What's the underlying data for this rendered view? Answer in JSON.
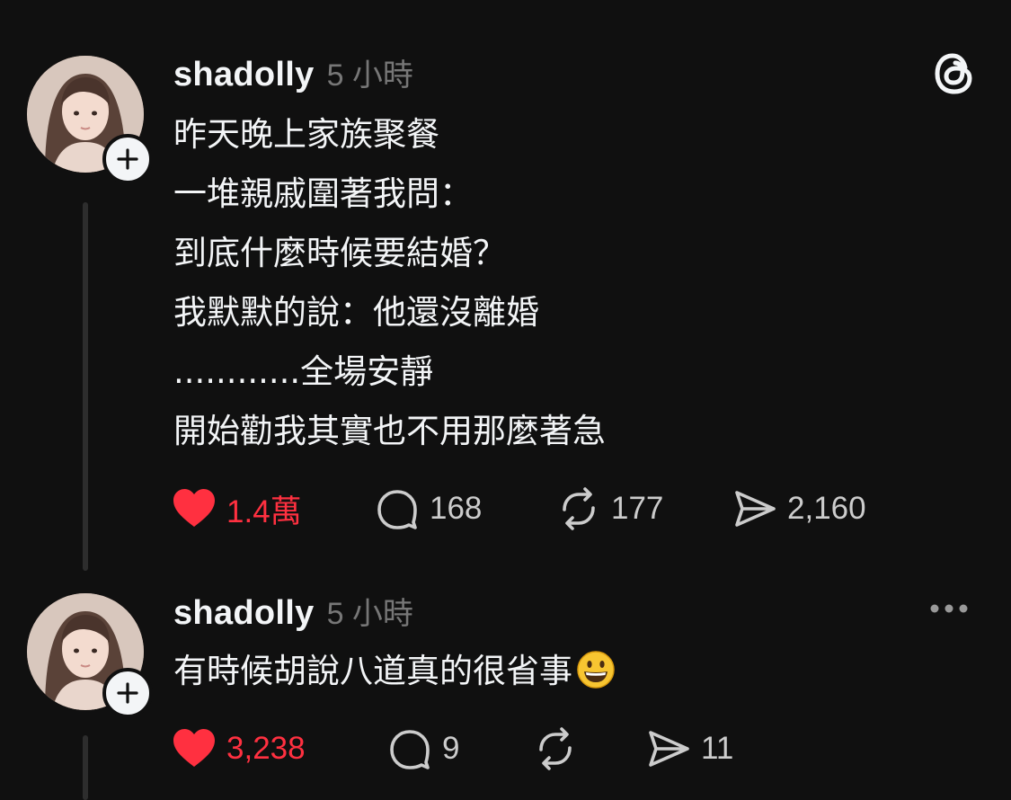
{
  "posts": [
    {
      "username": "shadolly",
      "time": "5 小時",
      "text": "昨天晚上家族聚餐\n一堆親戚圍著我問：\n到底什麼時候要結婚？\n我默默的說：他還沒離婚\n............全場安靜\n開始勸我其實也不用那麼著急",
      "likes": "1.4萬",
      "replies": "168",
      "reposts": "177",
      "shares": "2,160",
      "liked": true
    },
    {
      "username": "shadolly",
      "time": "5 小時",
      "text": "有時候胡說八道真的很省事",
      "emoji": "grinning-face-emoji",
      "likes": "3,238",
      "replies": "9",
      "reposts": "",
      "shares": "11",
      "liked": true
    }
  ],
  "icons": {
    "app_logo": "threads-logo-icon",
    "more": "more-options-icon",
    "like": "heart-icon",
    "reply": "comment-bubble-icon",
    "repost": "repost-icon",
    "share": "send-icon",
    "follow": "plus-icon"
  },
  "colors": {
    "background": "#101010",
    "text": "#f3f5f7",
    "muted": "#777777",
    "like": "#ff3040"
  }
}
